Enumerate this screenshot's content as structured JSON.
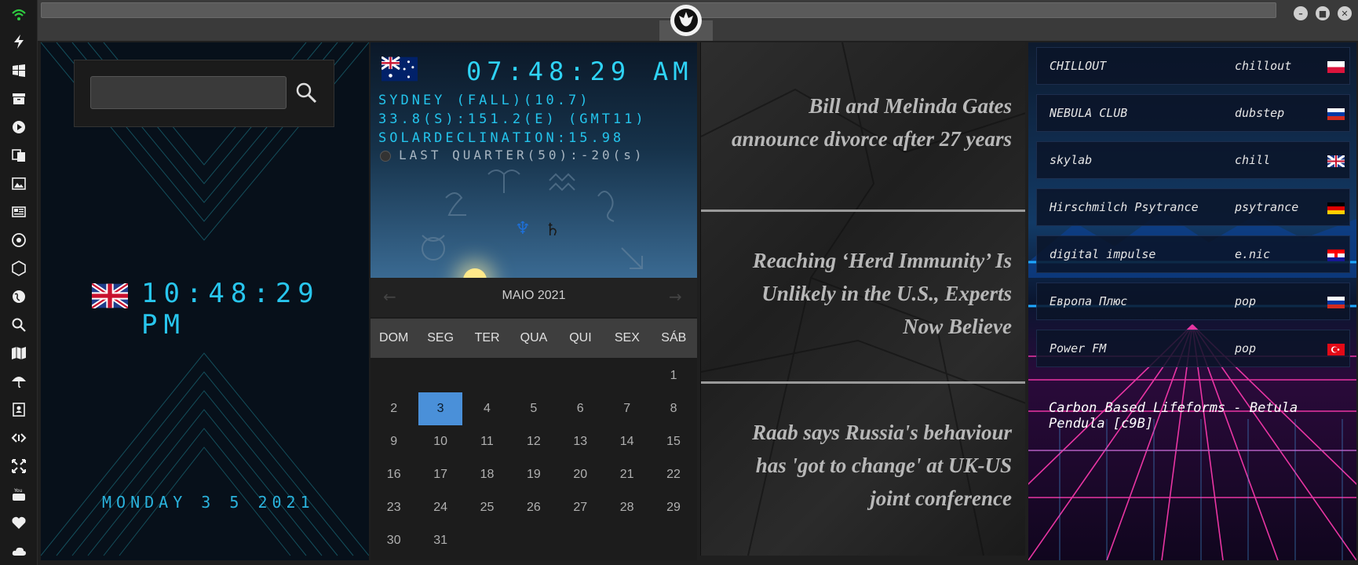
{
  "app": {
    "accent": "#1ec3ee",
    "background": "#1f1f1f"
  },
  "sidebar": {
    "icons": [
      "wifi-icon",
      "flash-icon",
      "windows-icon",
      "archive-icon",
      "play-icon",
      "translate-icon",
      "image-icon",
      "news-icon",
      "aperture-icon",
      "hexagon-icon",
      "globe-icon",
      "search-icon",
      "map-icon",
      "umbrella-icon",
      "contacts-icon",
      "code-icon",
      "fullscreen-icon",
      "youtube-icon",
      "heart-icon",
      "cloud-icon"
    ]
  },
  "window": {
    "controls": [
      "minimize",
      "maximize",
      "close"
    ]
  },
  "clock": {
    "search_placeholder": "",
    "time": "10:48:29 PM",
    "date": "MONDAY 3 5 2021"
  },
  "astro": {
    "time": "07:48:29",
    "ampm": "AM",
    "location": "SYDNEY (FALL)(10.7)",
    "coords": "33.8(S):151.2(E) (GMT11)",
    "solar": "SOLARDECLINATION:15.98",
    "moon": "LAST QUARTER(50):-20(s)"
  },
  "calendar": {
    "title": "MAIO 2021",
    "weekdays": [
      "DOM",
      "SEG",
      "TER",
      "QUA",
      "QUI",
      "SEX",
      "SÁB"
    ],
    "first_weekday_index": 6,
    "days_in_month": 31,
    "selected_day": 3
  },
  "news": [
    {
      "lines": [
        "Bill and Melinda Gates",
        "announce divorce after 27 years"
      ]
    },
    {
      "lines": [
        "Reaching ‘Herd Immunity’ Is",
        "Unlikely in the U.S., Experts",
        "Now Believe"
      ]
    },
    {
      "lines": [
        "Raab says Russia's behaviour",
        "has 'got to change' at UK-US",
        "joint conference"
      ]
    }
  ],
  "radio": {
    "stations": [
      {
        "name": "CHILLOUT",
        "genre": "chillout",
        "flag": "poland"
      },
      {
        "name": "NEBULA CLUB",
        "genre": "dubstep",
        "flag": "russia"
      },
      {
        "name": "skylab",
        "genre": "chill",
        "flag": "uk"
      },
      {
        "name": "Hirschmilch Psytrance",
        "genre": "psytrance",
        "flag": "germany"
      },
      {
        "name": "digital impulse",
        "genre": "e.nic",
        "flag": "croatia"
      },
      {
        "name": "Европа Плюс",
        "genre": "pop",
        "flag": "russia"
      },
      {
        "name": "Power FM",
        "genre": "pop",
        "flag": "turkey"
      }
    ],
    "now_playing": "Carbon Based Lifeforms - Betula Pendula [c9B]"
  }
}
